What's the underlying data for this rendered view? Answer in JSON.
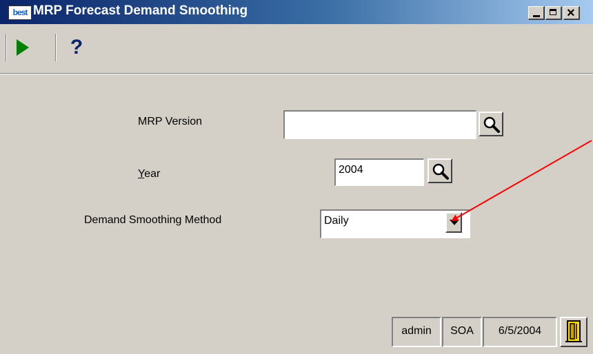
{
  "window": {
    "title": "MRP Forecast Demand Smoothing",
    "logo_text": "best",
    "controls": [
      "minimize",
      "maximize",
      "close"
    ]
  },
  "toolbar": {
    "items": [
      {
        "name": "run",
        "icon": "play-icon",
        "color": "#008000"
      },
      {
        "name": "help",
        "label": "?"
      }
    ]
  },
  "form": {
    "mrp_version": {
      "label": "MRP Version",
      "value": ""
    },
    "year": {
      "label_underlined": "Y",
      "label_rest": "ear",
      "value": "2004"
    },
    "demand_smoothing_method": {
      "label": "Demand Smoothing Method",
      "value": "Daily"
    }
  },
  "status_bar": {
    "user": "admin",
    "company": "SOA",
    "date": "6/5/2004"
  },
  "annotation": {
    "color": "#ff0000"
  }
}
